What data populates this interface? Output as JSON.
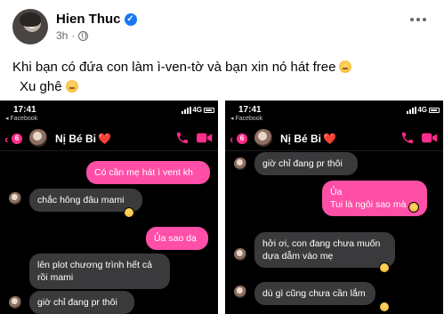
{
  "post": {
    "author": "Hien Thuc",
    "time": "3h",
    "dot": "·",
    "verified_icon": "verified-badge-icon",
    "privacy_icon": "globe-icon",
    "text_line1": "Khi bạn có đứa con làm ì-ven-tờ và bạn xin nó hát free",
    "text_line2": "Xu ghê",
    "accent": "#1877f2"
  },
  "screenshot_left": {
    "clock": "17:41",
    "network": "4G",
    "back_app": "◂ Facebook",
    "badge": "6",
    "contact": "Nị Bé Bi",
    "heart": "❤️",
    "messages": [
      {
        "dir": "out",
        "text": "Có cần mẹ hát ì vent kh"
      },
      {
        "dir": "in",
        "text": "chắc hông đâu mami"
      },
      {
        "dir": "out",
        "text": "Ủa sao dạ"
      },
      {
        "dir": "in",
        "text": "lên plot chương trình hết cả rồi mami"
      },
      {
        "dir": "in",
        "text": "giờ chỉ đang pr thôi"
      }
    ]
  },
  "screenshot_right": {
    "clock": "17:41",
    "network": "4G",
    "back_app": "◂ Facebook",
    "badge": "6",
    "contact": "Nị Bé Bi",
    "heart": "❤️",
    "messages": [
      {
        "dir": "in",
        "text": "giờ chỉ đang pr thôi"
      },
      {
        "dir": "out",
        "text": "Ủa\nTui là ngôi sao mà"
      },
      {
        "dir": "in",
        "text": "hởi ơi, con đang chưa muốn dựa dẫm vào mẹ"
      },
      {
        "dir": "in",
        "text": "dù gì cũng chưa cần lắm"
      }
    ]
  },
  "colors": {
    "outgoing_bubble": "#ff4fa7",
    "incoming_bubble": "#3a3a3c",
    "messenger_accent": "#ff2d8b"
  }
}
